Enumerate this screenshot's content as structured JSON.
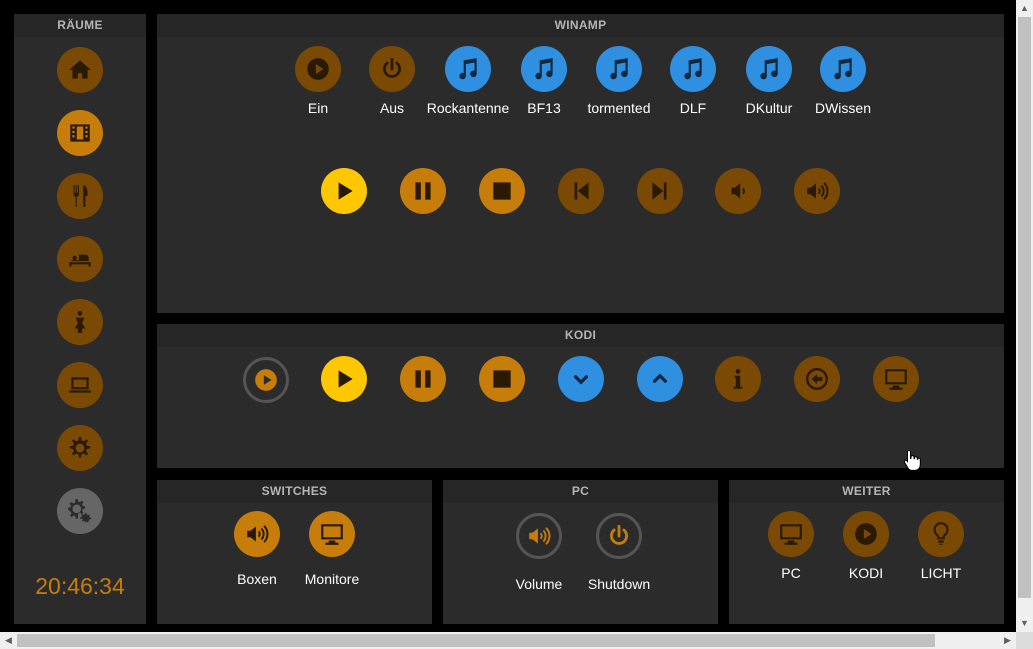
{
  "rooms": {
    "title": "RÄUME",
    "items": [
      {
        "icon": "home-icon"
      },
      {
        "icon": "film-icon"
      },
      {
        "icon": "dining-icon"
      },
      {
        "icon": "bed-icon"
      },
      {
        "icon": "person-icon"
      },
      {
        "icon": "laptop-icon"
      },
      {
        "icon": "gear-icon"
      },
      {
        "icon": "gears-icon"
      }
    ],
    "clock": "20:46:34"
  },
  "winamp": {
    "title": "WINAMP",
    "stations": [
      {
        "label": "Ein",
        "icon": "play-circle-icon"
      },
      {
        "label": "Aus",
        "icon": "power-icon"
      },
      {
        "label": "Rockantenne",
        "icon": "music-icon"
      },
      {
        "label": "BF13",
        "icon": "music-icon"
      },
      {
        "label": "tormented",
        "icon": "music-icon"
      },
      {
        "label": "DLF",
        "icon": "music-icon"
      },
      {
        "label": "DKultur",
        "icon": "music-icon"
      },
      {
        "label": "DWissen",
        "icon": "music-icon"
      }
    ],
    "controls": [
      "play-icon",
      "pause-icon",
      "stop-icon",
      "skip-back-icon",
      "skip-forward-icon",
      "volume-down-icon",
      "volume-up-icon"
    ]
  },
  "kodi": {
    "title": "KODI",
    "controls": [
      "play-circle-icon",
      "play-icon",
      "pause-icon",
      "stop-icon",
      "chevron-down-icon",
      "chevron-up-icon",
      "info-icon",
      "back-icon",
      "monitor-icon"
    ]
  },
  "switches": {
    "title": "SWITCHES",
    "items": [
      {
        "label": "Boxen",
        "icon": "speaker-icon"
      },
      {
        "label": "Monitore",
        "icon": "monitor-icon"
      }
    ]
  },
  "pc": {
    "title": "PC",
    "items": [
      {
        "label": "Volume",
        "icon": "speaker-icon"
      },
      {
        "label": "Shutdown",
        "icon": "power-icon"
      }
    ]
  },
  "weiter": {
    "title": "WEITER",
    "items": [
      {
        "label": "PC",
        "icon": "monitor-icon"
      },
      {
        "label": "KODI",
        "icon": "play-circle-icon"
      },
      {
        "label": "LICHT",
        "icon": "bulb-icon"
      }
    ]
  },
  "colors": {
    "accent": "#c77d0a",
    "dim_accent": "#7a4a04",
    "active": "#ffc700",
    "blue": "#2f8fe0",
    "panel": "#2b2b2b"
  }
}
